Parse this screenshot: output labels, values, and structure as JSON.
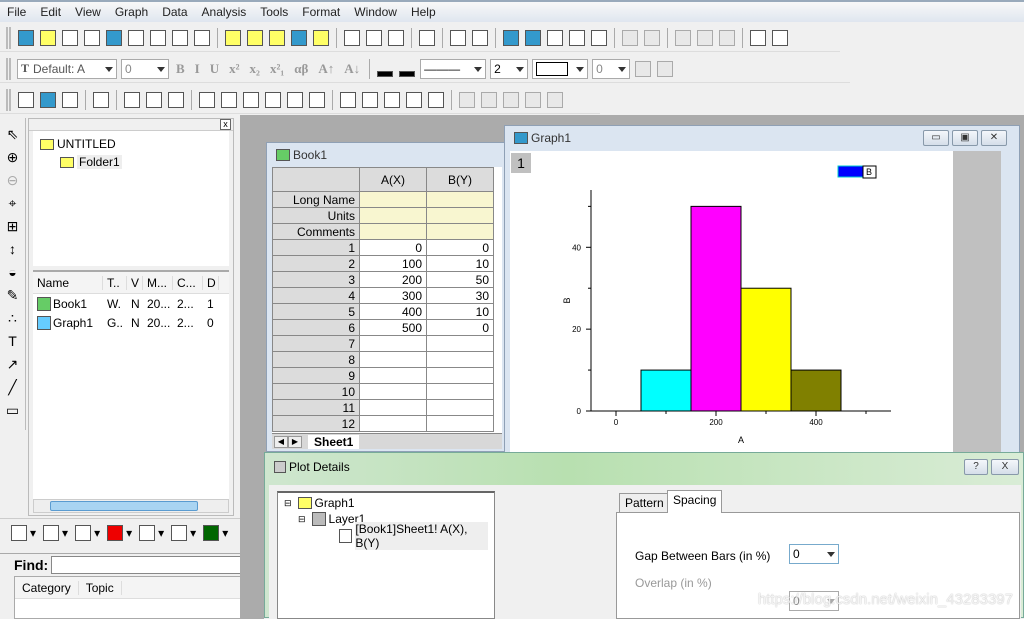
{
  "menu": [
    "File",
    "Edit",
    "View",
    "Graph",
    "Data",
    "Analysis",
    "Tools",
    "Format",
    "Window",
    "Help"
  ],
  "toolbar": {
    "row1_icons": [
      "new-project-icon",
      "new-folder-icon",
      "new-workbook-icon",
      "new-excel-icon",
      "new-graph-icon",
      "new-matrix-icon",
      "new-function-icon",
      "new-layout-icon",
      "new-notes-icon",
      "open-icon",
      "open-template-icon",
      "open-excel-icon",
      "save-project-icon",
      "save-template-icon",
      "import-wizard-icon",
      "import-ascii-icon",
      "import-multiple-ascii-icon",
      "print-icon",
      "code-builder-icon",
      "results-log-icon",
      "project-explorer-icon",
      "zoom-window-icon",
      "script-window-icon",
      "command-window-icon",
      "custom-routine-icon",
      "add-column-icon",
      "refresh-icon",
      "cut-icon",
      "copy-icon",
      "paste-icon",
      "add-layer-icon",
      "add-table-icon"
    ],
    "font_label": "Default: A",
    "font_size": "0",
    "styles": [
      "B",
      "I",
      "U",
      "x²",
      "x₂",
      "x²₁",
      "αβ",
      "A↑",
      "A↓"
    ],
    "line_style": "———",
    "line_width": "2",
    "fill_value": "0",
    "row3_icons": [
      "rescale-icon",
      "zoom-out-icon",
      "layer-content-icon",
      "data-reader-icon",
      "layout-1-icon",
      "layout-2-icon",
      "layout-4-icon",
      "axis-l-icon",
      "axis-dotted-icon",
      "axis-u-icon",
      "axis-box-icon",
      "axis-xy-icon",
      "axis-plot-icon",
      "legend-icon",
      "new-legend-icon",
      "color-scale-icon",
      "date-time-icon",
      "table-icon",
      "pen-icon",
      "mask-icon",
      "mask-table-icon",
      "unmask-icon",
      "hide-mask-icon"
    ]
  },
  "left_tools": [
    "pointer-icon",
    "zoom-in-icon",
    "zoom-out-icon",
    "screen-reader-icon",
    "data-selector-icon",
    "data-reader-icon",
    "mask-points-icon",
    "draw-data-icon",
    "regional-data-icon",
    "text-tool-icon",
    "arrow-tool-icon",
    "line-tool-icon",
    "rectangle-tool-icon"
  ],
  "explorer": {
    "root": "UNTITLED",
    "folder": "Folder1",
    "columns": [
      "Name",
      "T..",
      "V",
      "M...",
      "C...",
      "D"
    ],
    "rows": [
      {
        "name": "Book1",
        "t": "W.",
        "v": "N",
        "m": "20...",
        "c": "2...",
        "d": "1"
      },
      {
        "name": "Graph1",
        "t": "G..",
        "v": "N",
        "m": "20...",
        "c": "2...",
        "d": "0"
      }
    ]
  },
  "plot_toolbar": [
    "line-plot-icon",
    "scatter-plot-icon",
    "line-symbol-plot-icon",
    "column-plot-icon",
    "template-plot-icon",
    "stacked-plot-icon",
    "3d-surface-plot-icon"
  ],
  "find": {
    "label": "Find:",
    "value": "",
    "columns": [
      "Category",
      "Topic"
    ]
  },
  "book": {
    "title": "Book1",
    "columns": [
      "A(X)",
      "B(Y)"
    ],
    "meta_rows": [
      "Long Name",
      "Units",
      "Comments"
    ],
    "rows": [
      [
        "1",
        "0",
        "0"
      ],
      [
        "2",
        "100",
        "10"
      ],
      [
        "3",
        "200",
        "50"
      ],
      [
        "4",
        "300",
        "30"
      ],
      [
        "5",
        "400",
        "10"
      ],
      [
        "6",
        "500",
        "0"
      ],
      [
        "7",
        "",
        ""
      ],
      [
        "8",
        "",
        ""
      ],
      [
        "9",
        "",
        ""
      ],
      [
        "10",
        "",
        ""
      ],
      [
        "11",
        "",
        ""
      ],
      [
        "12",
        "",
        ""
      ]
    ],
    "sheet_tab": "Sheet1"
  },
  "graph": {
    "title": "Graph1",
    "layer_label": "1"
  },
  "chart_data": {
    "type": "bar",
    "x": [
      100,
      200,
      300,
      400
    ],
    "values": [
      10,
      50,
      30,
      10
    ],
    "colors": [
      "#00ffff",
      "#ff00ff",
      "#ffff00",
      "#808000"
    ],
    "xlabel": "A",
    "ylabel": "B",
    "xlim": [
      -50,
      550
    ],
    "ylim": [
      0,
      54
    ],
    "xticks": [
      0,
      200,
      400
    ],
    "yticks": [
      0,
      20,
      40
    ],
    "legend": {
      "label": "B",
      "color": "#0000ff",
      "position": "top-right"
    },
    "grid": false
  },
  "dialog": {
    "title": "Plot Details",
    "help": "?",
    "close": "X",
    "tree": [
      "Graph1",
      "Layer1",
      "[Book1]Sheet1! A(X), B(Y)"
    ],
    "tabs": [
      "Pattern",
      "Spacing"
    ],
    "gap_label": "Gap Between Bars (in %)",
    "gap_value": "0",
    "overlap_label": "Overlap (in %)",
    "overlap_value": "0"
  },
  "watermark": "https://blog.csdn.net/weixin_43283397"
}
